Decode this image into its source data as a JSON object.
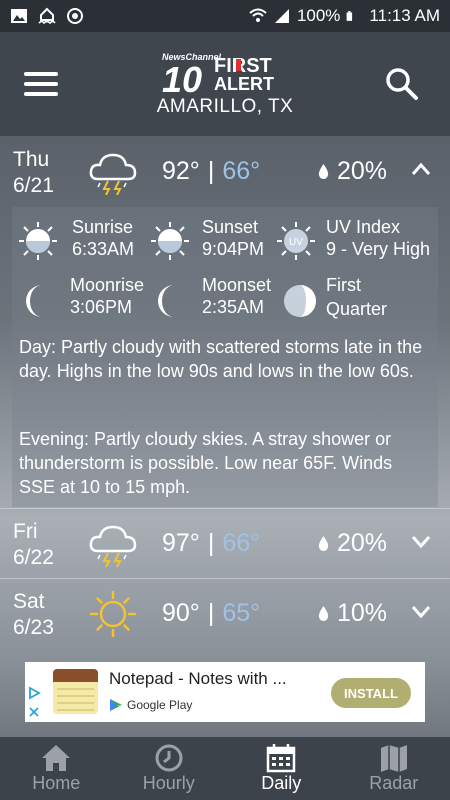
{
  "status_bar": {
    "battery": "100%",
    "time": "11:13 AM"
  },
  "header": {
    "logo_top": "NewsChannel",
    "logo_number": "10",
    "logo_first": "FIRST",
    "logo_alert": "ALERT",
    "city": "AMARILLO, TX"
  },
  "days": [
    {
      "name": "Thu",
      "date": "6/21",
      "hi": "92°",
      "lo": "66°",
      "precip": "20%",
      "icon": "cloud-lightning-icon",
      "expanded": true
    },
    {
      "name": "Fri",
      "date": "6/22",
      "hi": "97°",
      "lo": "66°",
      "precip": "20%",
      "icon": "cloud-lightning-icon",
      "expanded": false
    },
    {
      "name": "Sat",
      "date": "6/23",
      "hi": "90°",
      "lo": "65°",
      "precip": "10%",
      "icon": "sun-icon",
      "expanded": false
    }
  ],
  "details": {
    "sunrise_label": "Sunrise",
    "sunrise_time": "6:33AM",
    "sunset_label": "Sunset",
    "sunset_time": "9:04PM",
    "uv_label": "UV Index",
    "uv_value": "9 - Very High",
    "uv_icon_text": "UV",
    "moonrise_label": "Moonrise",
    "moonrise_time": "3:06PM",
    "moonset_label": "Moonset",
    "moonset_time": "2:35AM",
    "phase_line1": "First",
    "phase_line2": "Quarter",
    "day_text": "Day: Partly cloudy with scattered storms late in the day. Highs in the low 90s and lows in the low 60s.",
    "evening_text": "Evening: Partly cloudy skies. A stray shower or thunderstorm is possible. Low near 65F. Winds SSE at 10 to 15 mph."
  },
  "ad": {
    "title": "Notepad - Notes with ...",
    "store": "Google Play",
    "install": "INSTALL"
  },
  "nav": {
    "home": "Home",
    "hourly": "Hourly",
    "daily": "Daily",
    "radar": "Radar"
  },
  "colors": {
    "low_temp": "#9fc2e6",
    "header_bg": "#3f464e",
    "nav_bg": "#3c434a",
    "install_bg": "#b1ae72"
  }
}
